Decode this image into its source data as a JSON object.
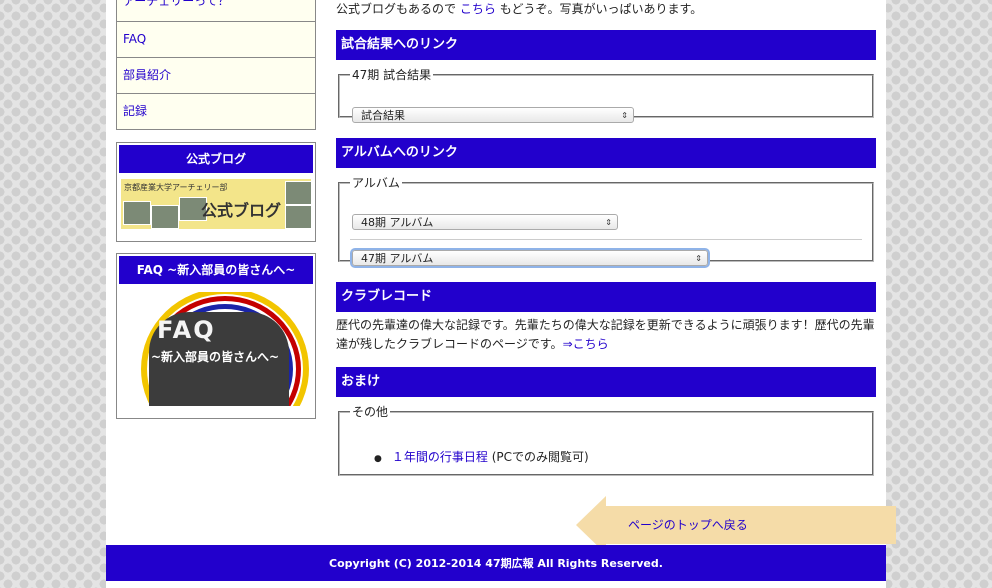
{
  "sidebar": {
    "nav": [
      "アーチェリーって？",
      "FAQ",
      "部員紹介",
      "記録"
    ],
    "blog_box": {
      "title": "公式ブログ",
      "banner_title": "公式ブログ",
      "banner_sub": "京都産業大学アーチェリー部"
    },
    "faq_box": {
      "title": "FAQ ~新入部員の皆さんへ~",
      "img_big": "FAQ",
      "img_sub": "~新入部員の皆さんへ~"
    }
  },
  "main": {
    "intro_text": "公式ブログもあるので",
    "intro_link": "こちら",
    "intro_tail": "もどうぞ。写真がいっぱいあります。",
    "results": {
      "heading": "試合結果へのリンク",
      "legend": "47期 試合結果",
      "select_value": "試合結果"
    },
    "album": {
      "heading": "アルバムへのリンク",
      "legend": "アルバム",
      "select1_value": "48期 アルバム",
      "select2_value": "47期 アルバム"
    },
    "records": {
      "heading": "クラブレコード",
      "text": "歴代の先輩達の偉大な記録です。先輩たちの偉大な記録を更新できるように頑張ります！歴代の先輩達が残したクラブレコードのページです。",
      "link": "⇒こちら"
    },
    "extras": {
      "heading": "おまけ",
      "legend": "その他",
      "item_link": "１年間の行事日程",
      "item_note": "(PCでのみ閲覧可)"
    },
    "back_to_top": "ページのトップへ戻る"
  },
  "footer": {
    "copyright": "Copyright (C) 2012-2014 47期広報 All Rights Reserved."
  },
  "colors": {
    "accent": "#2200cc",
    "link": "#2200cc",
    "totop": "#f5dca8"
  }
}
